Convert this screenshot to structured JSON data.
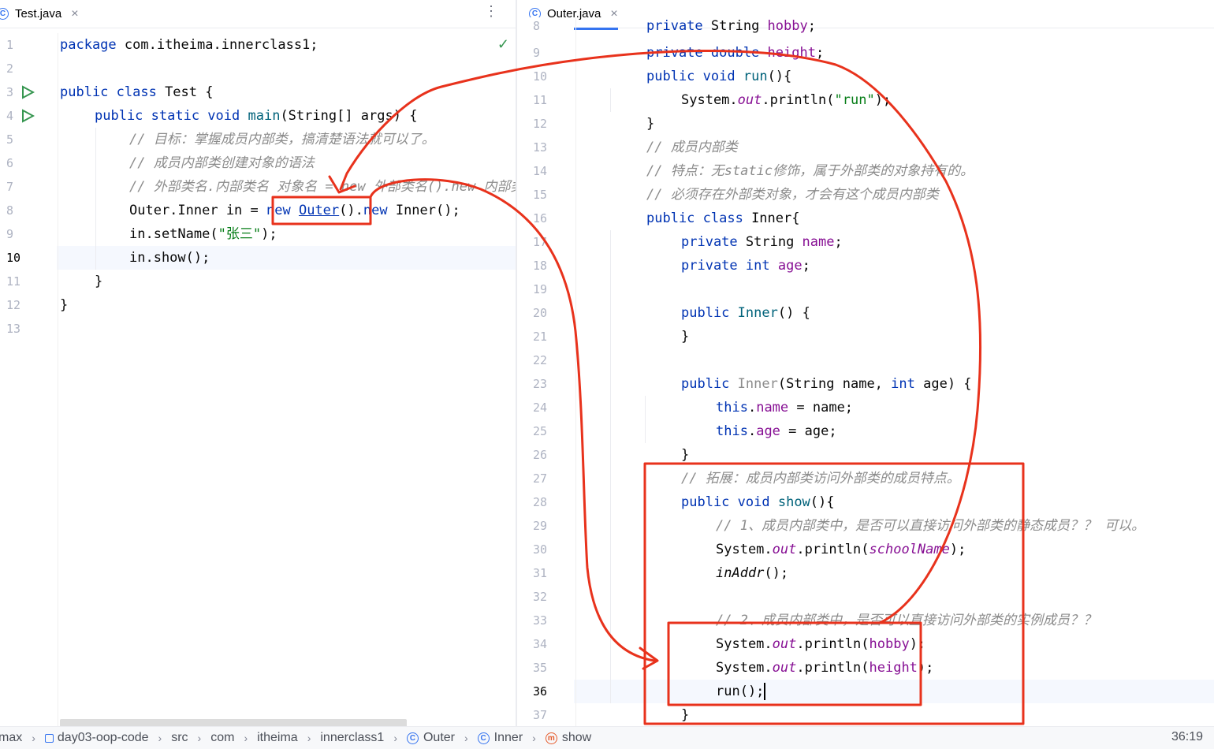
{
  "left": {
    "tab": {
      "label": "Test.java",
      "close": "×"
    },
    "more": "⋮",
    "check": "✓",
    "lines": [
      {
        "n": "1",
        "html": "<span class=\"kw\">package</span> com.itheima.innerclass1;",
        "indent": 0
      },
      {
        "n": "2",
        "html": "",
        "indent": 0
      },
      {
        "n": "3",
        "html": "<span class=\"kw\">public class</span> Test {",
        "indent": 0
      },
      {
        "n": "4",
        "html": "<span class=\"kw\">public static void</span> <span class=\"fn\">main</span>(String[] args) {",
        "indent": 1
      },
      {
        "n": "5",
        "html": "<span class=\"cmt\">// 目标：掌握成员内部类，搞清楚语法就可以了。</span>",
        "indent": 2
      },
      {
        "n": "6",
        "html": "<span class=\"cmt\">// 成员内部类创建对象的语法</span>",
        "indent": 2
      },
      {
        "n": "7",
        "html": "<span class=\"cmt\">// 外部类名.内部类名 对象名 = new 外部类名().new 内部类名();</span>",
        "indent": 2
      },
      {
        "n": "8",
        "html": "Outer.Inner in = <span class=\"kw\">new</span> <span class=\"link\">Outer</span>().<span class=\"kw\">new</span> Inner();",
        "indent": 2
      },
      {
        "n": "9",
        "html": "in.setName(<span class=\"str\">\"张三\"</span>);",
        "indent": 2
      },
      {
        "n": "10",
        "html": "in.show();",
        "indent": 2
      },
      {
        "n": "11",
        "html": "}",
        "indent": 1
      },
      {
        "n": "12",
        "html": "}",
        "indent": 0
      },
      {
        "n": "13",
        "html": "",
        "indent": 0
      }
    ]
  },
  "right": {
    "tab": {
      "label": "Outer.java",
      "close": "×"
    },
    "lines": [
      {
        "n": "8",
        "html": "<span class=\"kw\">private</span> String <span class=\"fld\">hobby</span>;",
        "indent": 1
      },
      {
        "n": "9",
        "html": "<span class=\"kw\">private double</span> <span class=\"fld\">height</span>;",
        "indent": 1
      },
      {
        "n": "10",
        "html": "<span class=\"kw\">public void</span> <span class=\"fn\">run</span>(){",
        "indent": 1
      },
      {
        "n": "11",
        "html": "System.<span class=\"static\">out</span>.println(<span class=\"str\">\"run\"</span>);",
        "indent": 2
      },
      {
        "n": "12",
        "html": "}",
        "indent": 1
      },
      {
        "n": "13",
        "html": "<span class=\"cmt\">// 成员内部类</span>",
        "indent": 1
      },
      {
        "n": "14",
        "html": "<span class=\"cmt\">// 特点：无static修饰，属于外部类的对象持有的。</span>",
        "indent": 1
      },
      {
        "n": "15",
        "html": "<span class=\"cmt\">// 必须存在外部类对象，才会有这个成员内部类</span>",
        "indent": 1
      },
      {
        "n": "16",
        "html": "<span class=\"kw\">public class</span> Inner{",
        "indent": 1
      },
      {
        "n": "17",
        "html": "<span class=\"kw\">private</span> String <span class=\"fld\">name</span>;",
        "indent": 2
      },
      {
        "n": "18",
        "html": "<span class=\"kw\">private int</span> <span class=\"fld\">age</span>;",
        "indent": 2
      },
      {
        "n": "19",
        "html": "",
        "indent": 2
      },
      {
        "n": "20",
        "html": "<span class=\"kw\">public</span> <span class=\"fn\">Inner</span>() {",
        "indent": 2
      },
      {
        "n": "21",
        "html": "}",
        "indent": 2
      },
      {
        "n": "22",
        "html": "",
        "indent": 2
      },
      {
        "n": "23",
        "html": "<span class=\"kw\">public</span> <span class=\"gray-kw\">Inner</span>(String name, <span class=\"kw\">int</span> age) {",
        "indent": 2
      },
      {
        "n": "24",
        "html": "<span class=\"kw\">this</span>.<span class=\"fld\">name</span> = name;",
        "indent": 3
      },
      {
        "n": "25",
        "html": "<span class=\"kw\">this</span>.<span class=\"fld\">age</span> = age;",
        "indent": 3
      },
      {
        "n": "26",
        "html": "}",
        "indent": 2
      },
      {
        "n": "27",
        "html": "<span class=\"cmt\">// 拓展：成员内部类访问外部类的成员特点。</span>",
        "indent": 2
      },
      {
        "n": "28",
        "html": "<span class=\"kw\">public void</span> <span class=\"fn\">show</span>(){",
        "indent": 2
      },
      {
        "n": "29",
        "html": "<span class=\"cmt\">// 1、成员内部类中，是否可以直接访问外部类的静态成员？？ 可以。</span>",
        "indent": 3
      },
      {
        "n": "30",
        "html": "System.<span class=\"static\">out</span>.println(<span class=\"static\">schoolName</span>);",
        "indent": 3
      },
      {
        "n": "31",
        "html": "<span class=\"ital\">inAddr</span>();",
        "indent": 3
      },
      {
        "n": "32",
        "html": "",
        "indent": 3
      },
      {
        "n": "33",
        "html": "<span class=\"cmt\">// 2、成员内部类中，是否可以直接访问外部类的实例成员？？</span>",
        "indent": 3
      },
      {
        "n": "34",
        "html": "System.<span class=\"static\">out</span>.println(<span class=\"fld\">hobby</span>);",
        "indent": 3
      },
      {
        "n": "35",
        "html": "System.<span class=\"static\">out</span>.println(<span class=\"fld\">height</span>);",
        "indent": 3
      },
      {
        "n": "36",
        "html": "run();<span class=\"caret\"></span>",
        "indent": 3
      },
      {
        "n": "37",
        "html": "}",
        "indent": 2
      }
    ]
  },
  "status": {
    "crumbs": [
      {
        "label": "max",
        "icon": ""
      },
      {
        "label": "day03-oop-code",
        "icon": "module"
      },
      {
        "label": "src",
        "icon": ""
      },
      {
        "label": "com",
        "icon": ""
      },
      {
        "label": "itheima",
        "icon": ""
      },
      {
        "label": "innerclass1",
        "icon": ""
      },
      {
        "label": "Outer",
        "icon": "class"
      },
      {
        "label": "Inner",
        "icon": "class"
      },
      {
        "label": "show",
        "icon": "method"
      }
    ],
    "position": "36:19"
  },
  "colors": {
    "annotation": "#e8321c",
    "accent": "#3574f0"
  }
}
